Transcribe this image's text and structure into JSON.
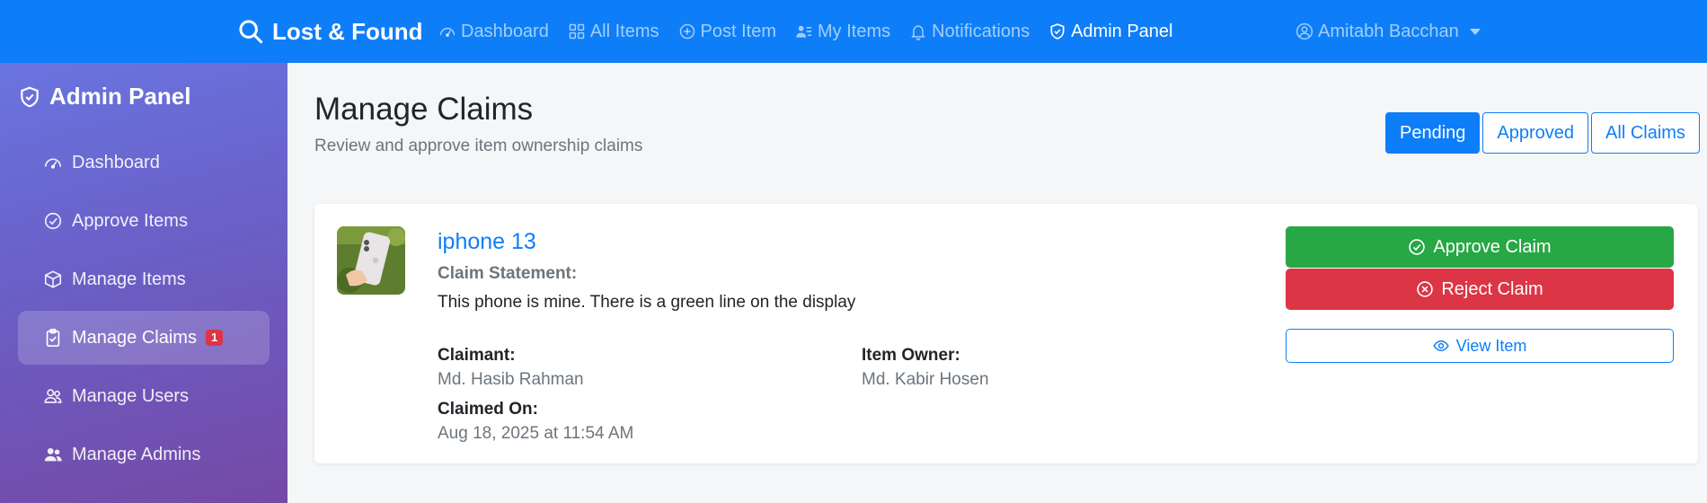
{
  "navbar": {
    "brand": "Lost & Found",
    "links": [
      {
        "label": "Dashboard",
        "icon": "speedometer-icon"
      },
      {
        "label": "All Items",
        "icon": "grid-icon"
      },
      {
        "label": "Post Item",
        "icon": "plus-circle-icon"
      },
      {
        "label": "My Items",
        "icon": "person-lines-icon"
      },
      {
        "label": "Notifications",
        "icon": "bell-icon"
      },
      {
        "label": "Admin Panel",
        "icon": "shield-check-icon",
        "active": true
      }
    ],
    "user": "Amitabh Bacchan"
  },
  "sidebar": {
    "title": "Admin Panel",
    "items": [
      {
        "label": "Dashboard",
        "icon": "speedometer-icon"
      },
      {
        "label": "Approve Items",
        "icon": "check-circle-icon"
      },
      {
        "label": "Manage Items",
        "icon": "box-icon"
      },
      {
        "label": "Manage Claims",
        "icon": "clipboard-check-icon",
        "badge": "1",
        "active": true
      },
      {
        "label": "Manage Users",
        "icon": "people-icon"
      },
      {
        "label": "Manage Admins",
        "icon": "people-fill-icon"
      }
    ]
  },
  "main": {
    "title": "Manage Claims",
    "subtitle": "Review and approve item ownership claims",
    "filters": [
      {
        "label": "Pending",
        "active": true
      },
      {
        "label": "Approved"
      },
      {
        "label": "All Claims"
      }
    ]
  },
  "claim": {
    "item_title": "iphone 13",
    "statement_label": "Claim Statement:",
    "statement": "This phone is mine. There is a green line on the display",
    "claimant_label": "Claimant:",
    "claimant": "Md. Hasib Rahman",
    "owner_label": "Item Owner:",
    "owner": "Md. Kabir Hosen",
    "claimed_on_label": "Claimed On:",
    "claimed_on": "Aug 18, 2025 at 11:54 AM",
    "approve_label": "Approve Claim",
    "reject_label": "Reject Claim",
    "view_label": "View Item"
  },
  "colors": {
    "primary": "#0d7ef8",
    "success": "#28a745",
    "danger": "#dc3545"
  }
}
